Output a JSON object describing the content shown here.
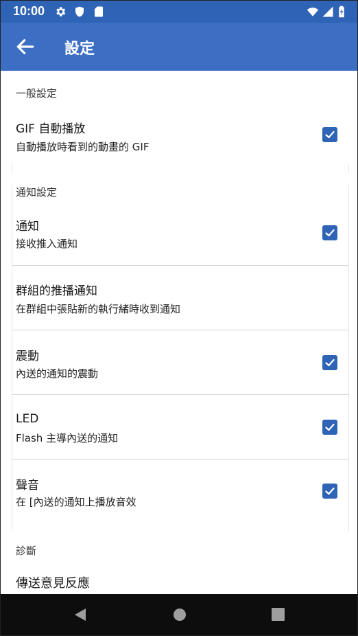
{
  "status_bar": {
    "time": "10:00",
    "icons_left": [
      "gear-icon",
      "shield-icon",
      "sd-card-icon"
    ],
    "icons_right": [
      "wifi-icon",
      "signal-icon",
      "battery-icon"
    ]
  },
  "app_bar": {
    "title": "設定",
    "back_icon": "arrow-left-icon"
  },
  "sections": {
    "general": {
      "header": "一般設定",
      "gif": {
        "title": "GIF 自動播放",
        "summary": "自動播放時看到的動畫的 GIF",
        "checked": true
      }
    },
    "notifications": {
      "header": "通知設定",
      "notify": {
        "title": "通知",
        "summary": "接收推入通知",
        "checked": true
      },
      "group": {
        "title": "群組的推播通知",
        "summary": "在群組中張貼新的執行緒時收到通知"
      },
      "vibrate": {
        "title": "震動",
        "summary": "內送的通知的震動",
        "checked": true
      },
      "led": {
        "title": "LED",
        "summary": "Flash 主導內送的通知",
        "checked": true
      },
      "sound": {
        "title": "聲音",
        "summary": "在 [內送的通知上播放音效",
        "checked": true
      }
    },
    "diagnostics": {
      "header": "診斷",
      "feedback": {
        "title": "傳送意見反應"
      }
    }
  },
  "nav_bar": {
    "buttons": [
      "back-triangle-icon",
      "home-circle-icon",
      "recents-square-icon"
    ]
  },
  "colors": {
    "status_bar": "#2f63b5",
    "app_bar": "#3c6fc4",
    "checkbox": "#2f63b5",
    "nav_bar": "#0d0d0d"
  }
}
